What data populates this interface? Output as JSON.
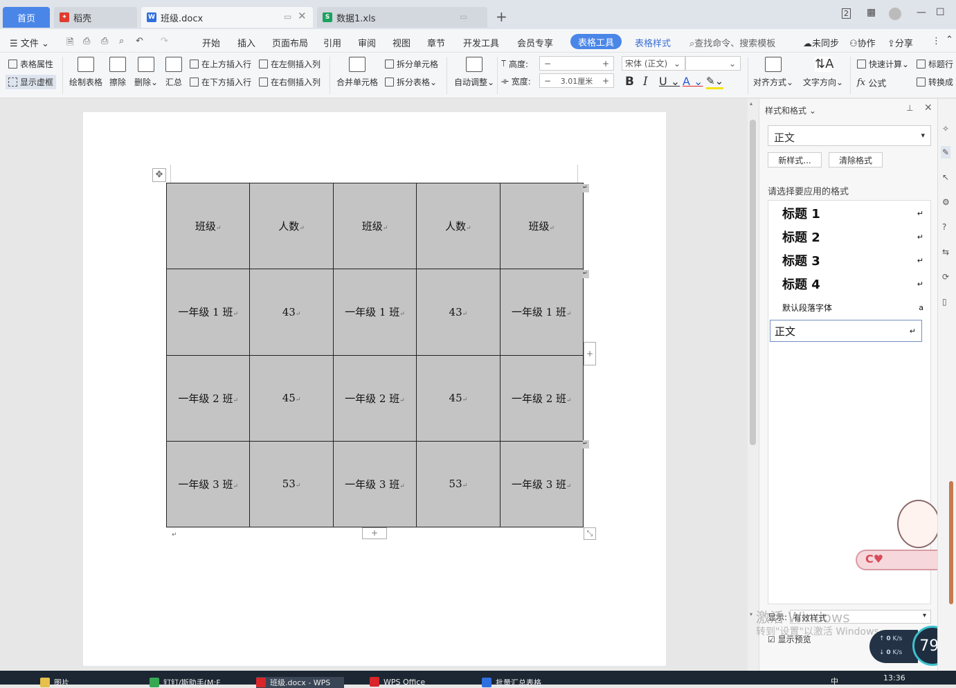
{
  "tabs": {
    "home": "首页",
    "daoke": "稻壳",
    "doc": "班级.docx",
    "xls": "数据1.xls"
  },
  "menu": {
    "file": "文件",
    "items": [
      "开始",
      "插入",
      "页面布局",
      "引用",
      "审阅",
      "视图",
      "章节",
      "开发工具",
      "会员专享"
    ],
    "table_tools": "表格工具",
    "table_style": "表格样式",
    "search": "查找命令、搜索模板",
    "unsynced": "未同步",
    "collab": "协作",
    "share": "分享"
  },
  "ribbon": {
    "table_props": "表格属性",
    "show_gridlines": "显示虚框",
    "draw_table": "绘制表格",
    "erase": "擦除",
    "delete": "删除",
    "summary": "汇总",
    "insert_above": "在上方插入行",
    "insert_below": "在下方插入行",
    "insert_left": "在左侧插入列",
    "insert_right": "在右侧插入列",
    "merge": "合并单元格",
    "split_cell": "拆分单元格",
    "split_table": "拆分表格",
    "autofit": "自动调整",
    "height_label": "高度:",
    "width_label": "宽度:",
    "width_value": "3.01厘米",
    "font_name": "宋体 (正文)",
    "align": "对齐方式",
    "text_dir": "文字方向",
    "quick_calc": "快速计算",
    "title_row": "标题行",
    "formula": "公式",
    "convert": "转换成"
  },
  "table": {
    "rows": [
      [
        "班级",
        "人数",
        "班级",
        "人数",
        "班级"
      ],
      [
        "一年级 1 班",
        "43",
        "一年级 1 班",
        "43",
        "一年级 1 班"
      ],
      [
        "一年级 2 班",
        "45",
        "一年级 2 班",
        "45",
        "一年级 2 班"
      ],
      [
        "一年级 3 班",
        "53",
        "一年级 3 班",
        "53",
        "一年级 3 班"
      ]
    ]
  },
  "panel": {
    "title": "样式和格式",
    "current_style": "正文",
    "new_style": "新样式...",
    "clear_format": "清除格式",
    "choose_label": "请选择要应用的格式",
    "styles": [
      "标题  1",
      "标题  2",
      "标题  3",
      "标题  4",
      "默认段落字体",
      "正文"
    ],
    "show_label": "显示:",
    "show_value": "有效样式",
    "preview": "显示预览"
  },
  "watermark": {
    "line1": "激活 Windows",
    "line2": "转到\"设置\"以激活 Windows。"
  },
  "speed": {
    "percent": "79",
    "up": "0",
    "down": "0",
    "unit": "K/s"
  },
  "taskbar": {
    "items": [
      "图片",
      "钉钉/斯助手(M:F",
      "班级.docx - WPS",
      "WPS Office",
      "批量汇总表格"
    ],
    "time": "13:36",
    "ime": "中"
  },
  "colors": {
    "accent": "#4a86e8",
    "table_fill": "#c4c4c4"
  }
}
